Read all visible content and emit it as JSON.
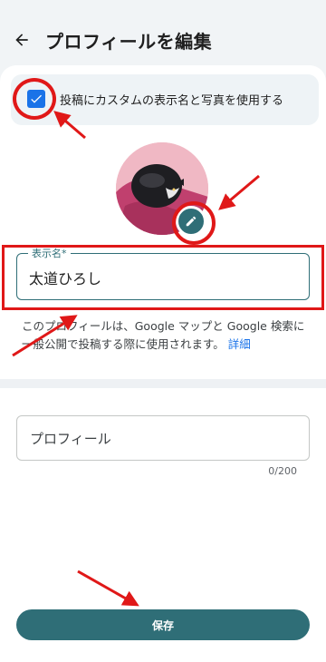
{
  "header": {
    "title": "プロフィールを編集",
    "back_icon": "arrow-left-icon"
  },
  "checkbox": {
    "checked": true,
    "label": "投稿にカスタムの表示名と写真を使用する",
    "color": "#1a73e8"
  },
  "avatar": {
    "edit_icon": "pencil-icon",
    "accent": "#2f6e77"
  },
  "display_name": {
    "label": "表示名*",
    "value": "太道ひろし"
  },
  "description": {
    "text": "このプロフィールは、Google マップと Google 検索に一般公開で投稿する際に使用されます。",
    "link_text": "詳細"
  },
  "profile": {
    "placeholder": "プロフィール",
    "counter": "0/200"
  },
  "save_button": {
    "label": "保存"
  }
}
